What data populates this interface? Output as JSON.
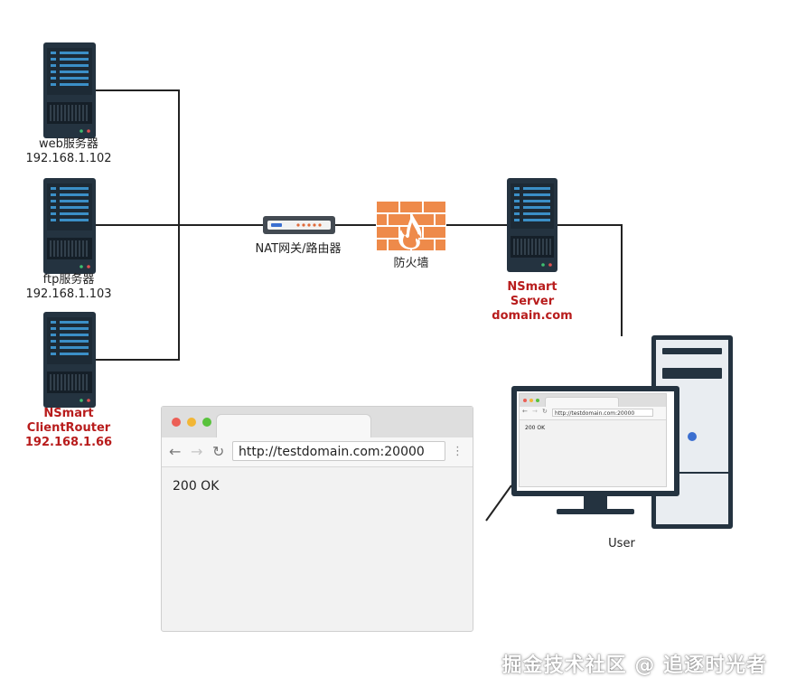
{
  "servers": [
    {
      "name": "web服务器",
      "ip": "192.168.1.102"
    },
    {
      "name": "ftp服务器",
      "ip": "192.168.1.103"
    }
  ],
  "client_router": {
    "line1": "NSmart",
    "line2": "ClientRouter",
    "ip": "192.168.1.66"
  },
  "nat_label": "NAT网关/路由器",
  "firewall_label": "防火墙",
  "nsmart_server": {
    "line1": "NSmart",
    "line2": "Server",
    "domain": "domain.com"
  },
  "user_label": "User",
  "browser": {
    "url": "http://testdomain.com:20000",
    "content": "200 OK",
    "menu_icon": "⋮"
  },
  "monitor_browser": {
    "url": "http://testdomain.com:20000",
    "content": "200 OK"
  },
  "watermark": "掘金技术社区 @ 追逐时光者",
  "colors": {
    "accent_red": "#b81c1c",
    "server_dark": "#243340",
    "server_blue": "#3b8fc7",
    "firewall": "#ee8a4a"
  }
}
